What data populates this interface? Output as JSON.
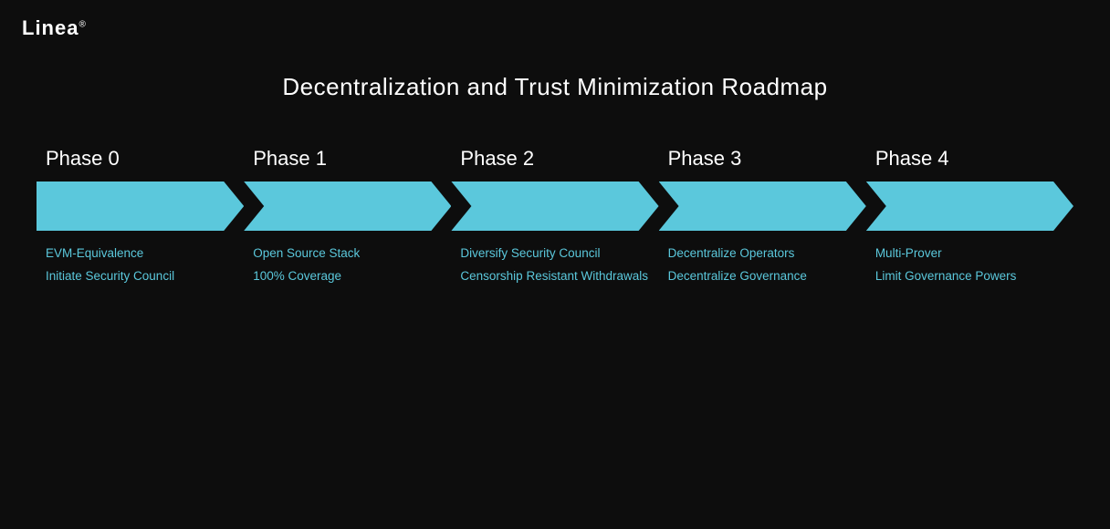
{
  "logo": {
    "text": "Linea",
    "sup": "®"
  },
  "main_title": "Decentralization and Trust Minimization Roadmap",
  "phases": [
    {
      "label": "Phase 0"
    },
    {
      "label": "Phase 1"
    },
    {
      "label": "Phase 2"
    },
    {
      "label": "Phase 3"
    },
    {
      "label": "Phase 4"
    }
  ],
  "features": [
    [
      {
        "text": "EVM-Equivalence"
      },
      {
        "text": "Initiate Security Council"
      }
    ],
    [
      {
        "text": "Open Source Stack"
      },
      {
        "text": "100% Coverage"
      }
    ],
    [
      {
        "text": "Diversify Security Council"
      },
      {
        "text": "Censorship Resistant Withdrawals"
      }
    ],
    [
      {
        "text": "Decentralize Operators"
      },
      {
        "text": "Decentralize Governance"
      }
    ],
    [
      {
        "text": "Multi-Prover"
      },
      {
        "text": "Limit Governance Powers"
      }
    ]
  ]
}
